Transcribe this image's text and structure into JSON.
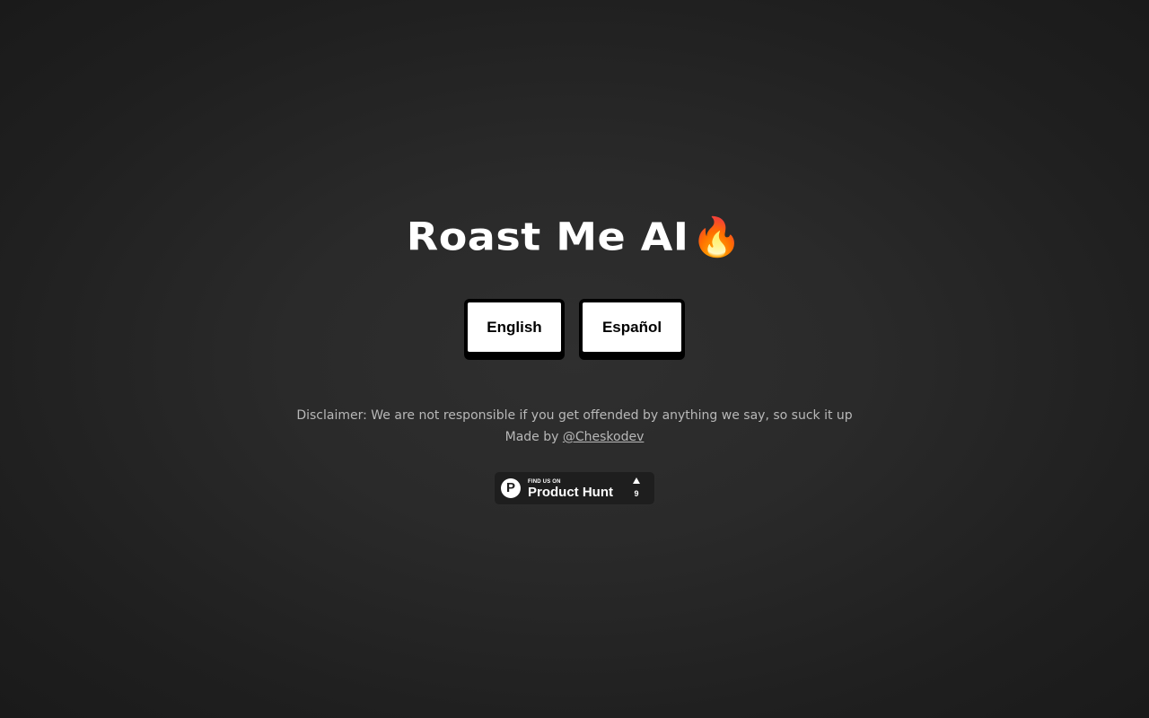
{
  "header": {
    "title": "Roast Me AI",
    "title_emoji": "🔥"
  },
  "languages": {
    "english_label": "English",
    "spanish_label": "Español"
  },
  "footer": {
    "disclaimer": "Disclaimer: We are not responsible if you get offended by anything we say, so suck it up",
    "made_by_prefix": "Made by",
    "author_handle": "@Cheskodev"
  },
  "product_hunt": {
    "logo_letter": "P",
    "small_text": "FIND US ON",
    "big_text": "Product Hunt",
    "upvote_count": "9"
  },
  "colors": {
    "background": "#2a2a2a",
    "button_bg": "#ffffff",
    "button_border": "#000000",
    "muted_text": "#b8b8b8"
  }
}
